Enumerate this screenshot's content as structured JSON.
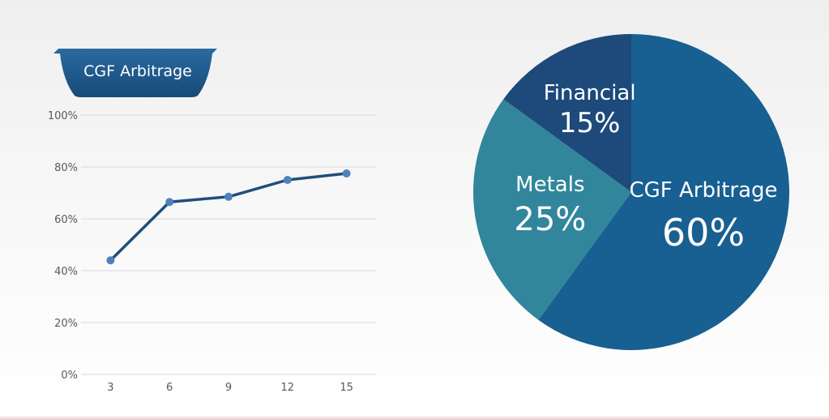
{
  "header_badge": {
    "label": "CGF Arbitrage"
  },
  "colors": {
    "line": "#1f4e79",
    "marker": "#4f81bd",
    "grid": "#d9d9d9",
    "badge": "#1f5a8c"
  },
  "chart_data": [
    {
      "type": "line",
      "title": "",
      "xlabel": "",
      "ylabel": "",
      "categories": [
        "3",
        "6",
        "9",
        "12",
        "15"
      ],
      "values": [
        44,
        66.5,
        68.5,
        75,
        77.5
      ],
      "ylim": [
        0,
        100
      ],
      "yticks": [
        "0%",
        "20%",
        "40%",
        "60%",
        "80%",
        "100%"
      ],
      "grid": true,
      "legend": "none"
    },
    {
      "type": "pie",
      "slices": [
        {
          "label": "CGF Arbitrage",
          "value_label": "60%",
          "value": 60,
          "color": "#185f92"
        },
        {
          "label": "Metals",
          "value_label": "25%",
          "value": 25,
          "color": "#31869b"
        },
        {
          "label": "Financial",
          "value_label": "15%",
          "value": 15,
          "color": "#1d4a7b"
        }
      ],
      "start_angle_deg": 0,
      "direction": "clockwise",
      "legend": "none"
    }
  ]
}
